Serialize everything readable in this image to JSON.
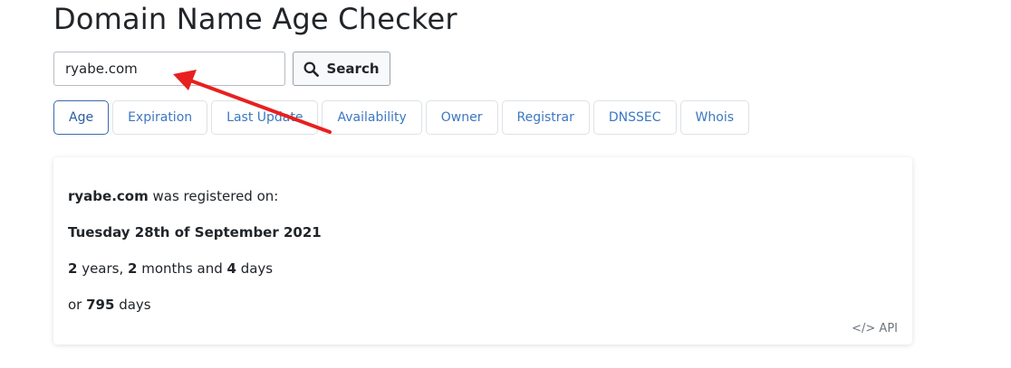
{
  "page": {
    "title": "Domain Name Age Checker"
  },
  "search": {
    "value": "ryabe.com",
    "button_label": "Search",
    "button_icon": "search-icon"
  },
  "tabs": [
    {
      "label": "Age",
      "active": true
    },
    {
      "label": "Expiration",
      "active": false
    },
    {
      "label": "Last Update",
      "active": false
    },
    {
      "label": "Availability",
      "active": false
    },
    {
      "label": "Owner",
      "active": false
    },
    {
      "label": "Registrar",
      "active": false
    },
    {
      "label": "DNSSEC",
      "active": false
    },
    {
      "label": "Whois",
      "active": false
    }
  ],
  "result": {
    "domain": "ryabe.com",
    "registered_text": " was registered on:",
    "registration_date": "Tuesday 28th of September 2021",
    "years": "2",
    "years_label": " years, ",
    "months": "2",
    "months_label": " months and ",
    "days": "4",
    "days_label": " days",
    "total_prefix": "or ",
    "total_days": "795",
    "total_suffix": " days"
  },
  "api": {
    "icon": "code-icon",
    "label": "API"
  },
  "colors": {
    "tab_text": "#3c78c0",
    "active_tab_border": "#3c6aa8",
    "annotation_arrow": "#e8201f"
  }
}
